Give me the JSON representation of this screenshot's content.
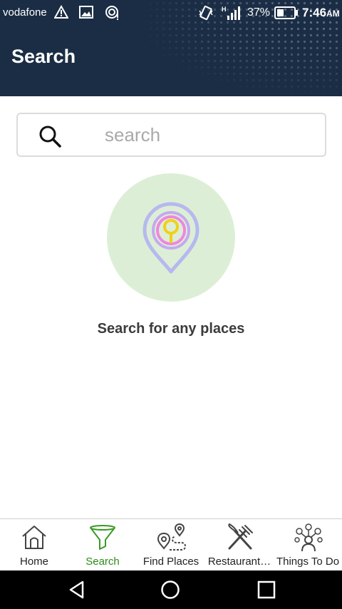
{
  "status_bar": {
    "carrier": "vodafone",
    "battery_percent": "37%",
    "time": "7:46",
    "time_suffix": "AM",
    "icons": [
      "warning-icon",
      "image-icon",
      "location-broadcast-icon",
      "vibrate-icon",
      "signal-icon",
      "battery-icon"
    ]
  },
  "header": {
    "title": "Search"
  },
  "search": {
    "placeholder": "search",
    "value": ""
  },
  "empty_state": {
    "message": "Search for any places"
  },
  "bottom_nav": {
    "items": [
      {
        "label": "Home",
        "icon": "home-icon",
        "active": false
      },
      {
        "label": "Search",
        "icon": "funnel-icon",
        "active": true
      },
      {
        "label": "Find Places",
        "icon": "route-map-icon",
        "active": false
      },
      {
        "label": "Restaurant…",
        "icon": "fork-knife-icon",
        "active": false
      },
      {
        "label": "Things To Do",
        "icon": "activities-icon",
        "active": false
      }
    ]
  },
  "system_nav": {
    "icons": [
      "back-icon",
      "home-circle-icon",
      "recents-icon"
    ]
  },
  "colors": {
    "header_bg": "#1b2d44",
    "accent_green": "#2e8b1a",
    "illustration_bg": "#dcefd6"
  }
}
